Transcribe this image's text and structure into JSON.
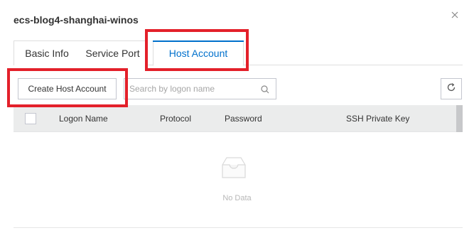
{
  "dialog": {
    "title": "ecs-blog4-shanghai-winos"
  },
  "tabs": [
    {
      "label": "Basic Info",
      "active": false
    },
    {
      "label": "Service Port",
      "active": false
    },
    {
      "label": "Host Account",
      "active": true
    }
  ],
  "toolbar": {
    "create_label": "Create Host Account",
    "search_placeholder": "Search by logon name",
    "search_value": ""
  },
  "table": {
    "columns": [
      "Logon Name",
      "Protocol",
      "Password",
      "SSH Private Key"
    ],
    "rows": []
  },
  "empty": {
    "text": "No Data"
  },
  "icons": {
    "close": "close-icon",
    "search": "search-icon",
    "refresh": "refresh-icon",
    "empty": "empty-box-icon"
  },
  "colors": {
    "accent": "#0070cc",
    "highlight": "#e3202a",
    "header_bg": "#ebecec"
  }
}
